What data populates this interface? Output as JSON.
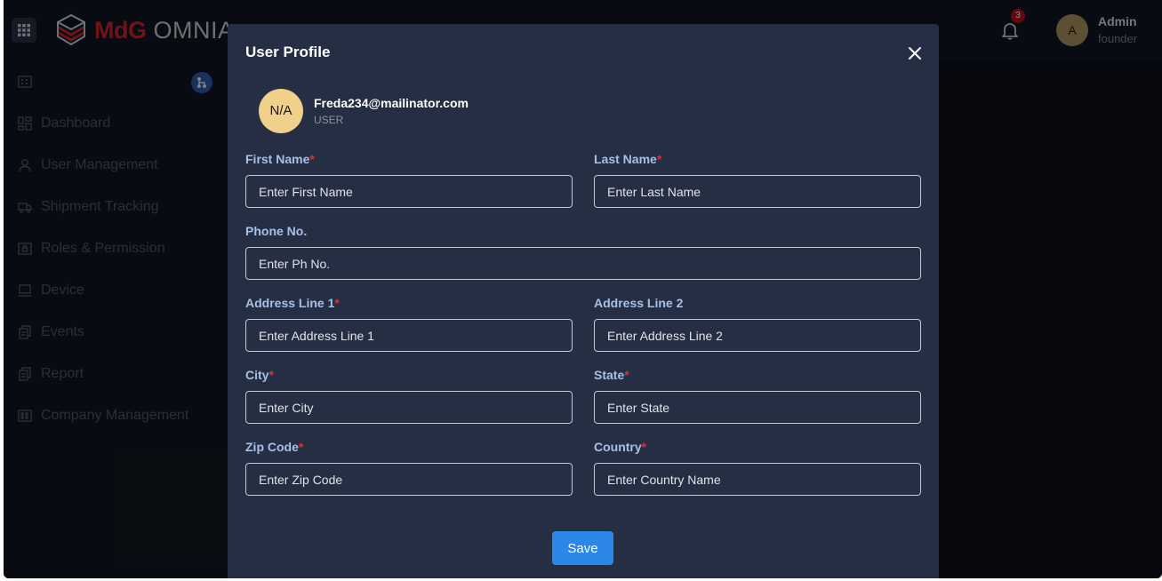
{
  "header": {
    "logo_brand": "MdG",
    "logo_suffix": "OMNIA",
    "notification_count": "3",
    "user_initial": "A",
    "user_name": "Admin",
    "user_role": "founder"
  },
  "sidebar": {
    "items": [
      {
        "label": "Dashboard",
        "icon": "dashboard-icon"
      },
      {
        "label": "User Management",
        "icon": "user-icon"
      },
      {
        "label": "Shipment Tracking",
        "icon": "truck-icon"
      },
      {
        "label": "Roles & Permission",
        "icon": "lock-icon"
      },
      {
        "label": "Device",
        "icon": "laptop-icon"
      },
      {
        "label": "Events",
        "icon": "copy-icon"
      },
      {
        "label": "Report",
        "icon": "copy-icon"
      },
      {
        "label": "Company Management",
        "icon": "building-icon"
      }
    ]
  },
  "modal": {
    "title": "User Profile",
    "profile": {
      "initials": "N/A",
      "email": "Freda234@mailinator.com",
      "role": "USER"
    },
    "fields": {
      "first_name": {
        "label": "First Name",
        "placeholder": "Enter First Name",
        "required": true
      },
      "last_name": {
        "label": "Last Name",
        "placeholder": "Enter Last Name",
        "required": true
      },
      "phone": {
        "label": "Phone No.",
        "placeholder": "Enter Ph No.",
        "required": false
      },
      "address1": {
        "label": "Address Line 1",
        "placeholder": "Enter Address Line 1",
        "required": true
      },
      "address2": {
        "label": "Address Line 2",
        "placeholder": "Enter Address Line 2",
        "required": false
      },
      "city": {
        "label": "City",
        "placeholder": "Enter City",
        "required": true
      },
      "state": {
        "label": "State",
        "placeholder": "Enter State",
        "required": true
      },
      "zip": {
        "label": "Zip Code",
        "placeholder": "Enter Zip Code",
        "required": true
      },
      "country": {
        "label": "Country",
        "placeholder": "Enter Country Name",
        "required": true
      }
    },
    "required_mark": "*",
    "save_label": "Save"
  },
  "colors": {
    "accent": "#2b87e8",
    "required": "#d2353a",
    "brand_red": "#c8262d"
  }
}
